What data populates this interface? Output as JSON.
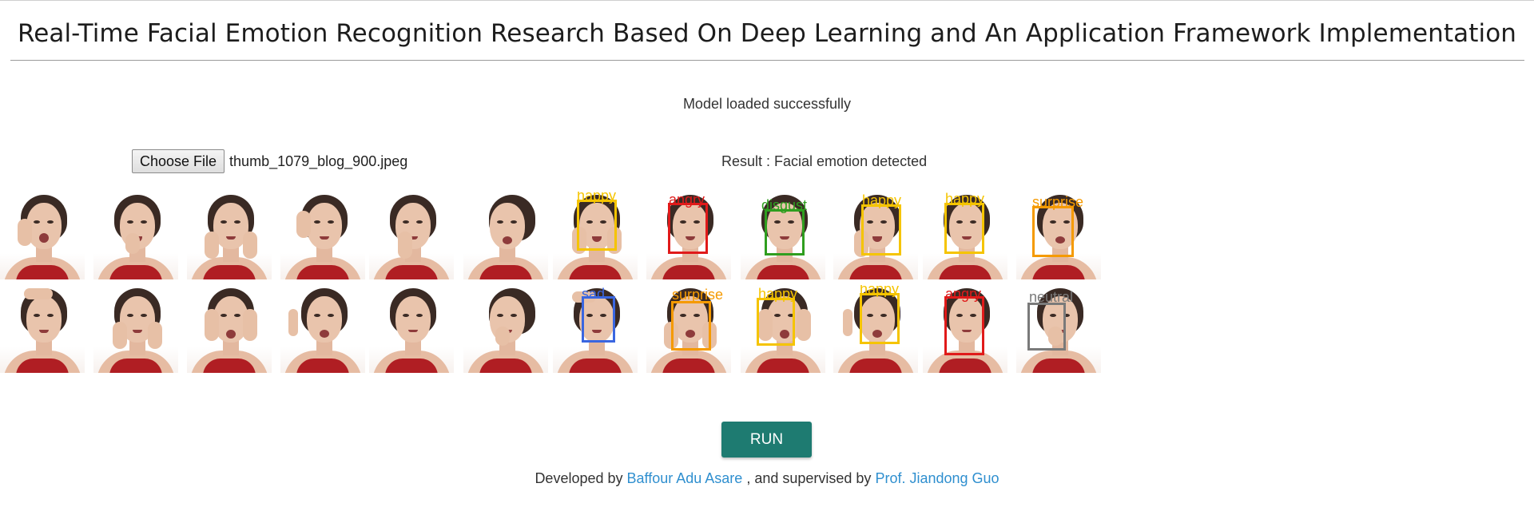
{
  "header": {
    "title": "Real-Time Facial Emotion Recognition Research Based On Deep Learning and An Application Framework Implementation"
  },
  "status": {
    "model_text": "Model loaded successfully",
    "result_text": "Result : Facial emotion detected"
  },
  "file_input": {
    "button_label": "Choose File",
    "file_name": "thumb_1079_blog_900.jpeg"
  },
  "detections": {
    "row1": [
      "happy",
      "angry",
      "disgust",
      "happy",
      "happy",
      "surprise"
    ],
    "row2": [
      "sad",
      "surprise",
      "happy",
      "happy",
      "angry",
      "neutral"
    ]
  },
  "emotion_colors": {
    "happy": "#f5c400",
    "angry": "#e01a1a",
    "disgust": "#2f9e1f",
    "surprise": "#f59a00",
    "sad": "#3a66e0",
    "neutral": "#7a7a7a"
  },
  "actions": {
    "run_label": "RUN"
  },
  "footer": {
    "developed_prefix": "Developed by",
    "developer_name": "Baffour Adu Asare",
    "middle_text": ", and supervised by",
    "supervisor_name": "Prof. Jiandong Guo"
  },
  "colors": {
    "run_button": "#1e7b71",
    "link": "#2f8fcf"
  }
}
